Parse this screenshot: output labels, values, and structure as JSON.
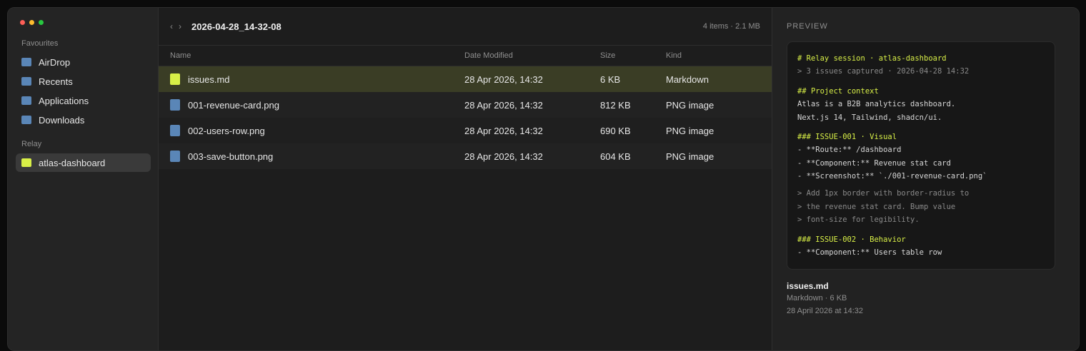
{
  "sidebar": {
    "favourites_title": "Favourites",
    "favourites": [
      "AirDrop",
      "Recents",
      "Applications",
      "Downloads"
    ],
    "relay_title": "Relay",
    "relay_items": [
      "atlas-dashboard"
    ]
  },
  "toolbar": {
    "back": "‹",
    "forward": "›",
    "title": "2026-04-28_14-32-08",
    "meta": "4 items · 2.1 MB"
  },
  "columns": {
    "name": "Name",
    "date": "Date Modified",
    "size": "Size",
    "kind": "Kind"
  },
  "files": [
    {
      "name": "issues.md",
      "date": "28 Apr 2026, 14:32",
      "size": "6 KB",
      "kind": "Markdown"
    },
    {
      "name": "001-revenue-card.png",
      "date": "28 Apr 2026, 14:32",
      "size": "812 KB",
      "kind": "PNG image"
    },
    {
      "name": "002-users-row.png",
      "date": "28 Apr 2026, 14:32",
      "size": "690 KB",
      "kind": "PNG image"
    },
    {
      "name": "003-save-button.png",
      "date": "28 Apr 2026, 14:32",
      "size": "604 KB",
      "kind": "PNG image"
    }
  ],
  "preview": {
    "label": "PREVIEW",
    "lines": [
      "# Relay session · atlas-dashboard",
      "> 3 issues captured · 2026-04-28 14:32",
      "## Project context",
      "Atlas is a B2B analytics dashboard.",
      "Next.js 14, Tailwind, shadcn/ui.",
      "### ISSUE-001 · Visual",
      "- **Route:** /dashboard",
      "- **Component:** Revenue stat card",
      "- **Screenshot:** `./001-revenue-card.png`",
      "> Add 1px border with border-radius to",
      "> the revenue stat card. Bump value",
      "> font-size for legibility.",
      "### ISSUE-002 · Behavior",
      "- **Component:** Users table row"
    ],
    "file_name": "issues.md",
    "file_kind": "Markdown · 6 KB",
    "file_date": "28 April 2026 at 14:32"
  },
  "colors": {
    "accent": "#d8ef47",
    "folder": "#5a86b7",
    "selected_row": "#3a3d25"
  }
}
